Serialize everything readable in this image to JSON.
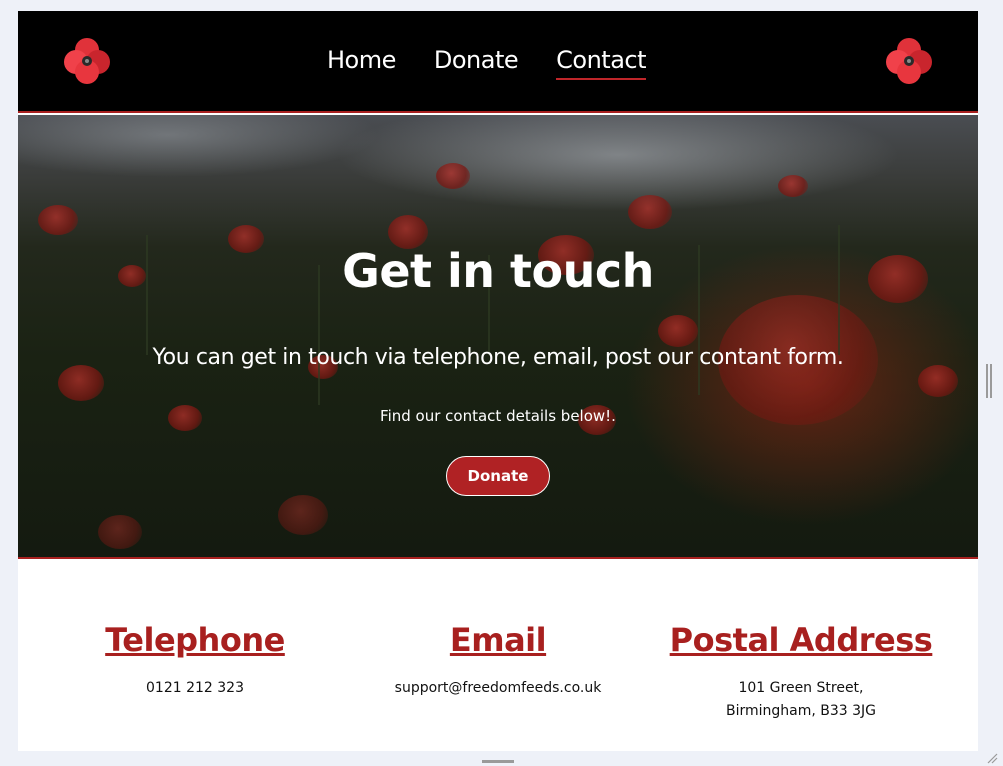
{
  "header": {
    "nav": [
      {
        "label": "Home",
        "active": false
      },
      {
        "label": "Donate",
        "active": false
      },
      {
        "label": "Contact",
        "active": true
      }
    ],
    "logo_icon": "poppy-logo-icon"
  },
  "hero": {
    "title": "Get in touch",
    "subtitle": "You can get in touch via telephone, email, post our contant form.",
    "note": "Find our contact details below!.",
    "button_label": "Donate"
  },
  "contact": {
    "telephone": {
      "heading": "Telephone",
      "lines": [
        "0121 212 323"
      ]
    },
    "email": {
      "heading": "Email",
      "lines": [
        "support@freedomfeeds.co.uk"
      ]
    },
    "postal": {
      "heading": "Postal Address",
      "lines": [
        "101 Green Street,",
        "Birmingham, B33 3JG"
      ]
    }
  },
  "colors": {
    "accent": "#a8201f",
    "button": "#b02224",
    "header_bg": "#000000"
  }
}
